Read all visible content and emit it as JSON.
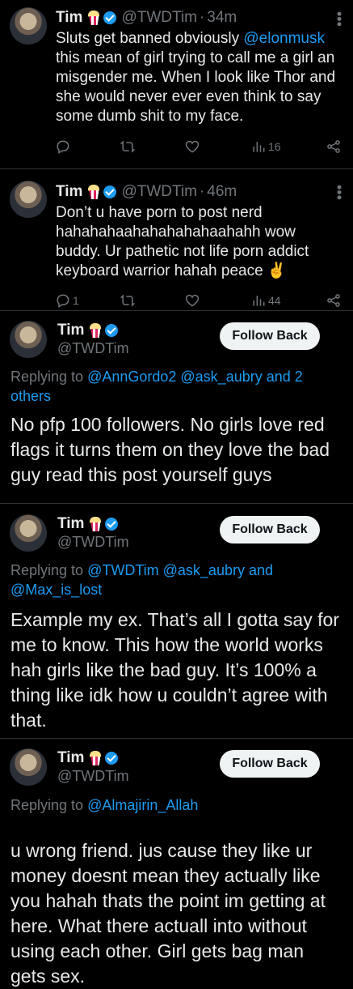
{
  "tweets_compact": [
    {
      "name": "Tim",
      "handle": "@TWDTim",
      "dot": "·",
      "time": "34m",
      "text_before": "Sluts get banned obviously ",
      "mention": "@elonmusk",
      "text_after": " this mean of girl trying to call me a girl an misgender me. When I look like Thor and she would never ever even think to say some dumb shit to my face.",
      "reply_count": "",
      "views": "16"
    },
    {
      "name": "Tim",
      "handle": "@TWDTim",
      "dot": "·",
      "time": "46m",
      "text": "Don’t u have porn to post nerd hahahahaahahahahahaahahh wow buddy. Ur pathetic not life porn addict keyboard warrior hahah peace ✌️",
      "reply_count": "1",
      "views": "44"
    }
  ],
  "tweets_full": [
    {
      "name": "Tim",
      "handle": "@TWDTim",
      "follow_label": "Follow Back",
      "replying_prefix": "Replying to ",
      "replying_mentions": "@AnnGordo2 @ask_aubry",
      "replying_suffix": " and ",
      "replying_others": "2 others",
      "text": "No pfp 100 followers. No girls love red flags it turns them on they love the bad guy read this post yourself guys"
    },
    {
      "name": "Tim",
      "handle": "@TWDTim",
      "follow_label": "Follow Back",
      "replying_prefix": "Replying to ",
      "replying_mentions": "@TWDTim @ask_aubry",
      "replying_suffix": " and ",
      "replying_others": "@Max_is_lost",
      "text": "Example my ex. That’s all I gotta say for me to know. This how the world works hah girls like the bad guy. It’s 100% a thing like idk how u couldn’t agree with that."
    },
    {
      "name": "Tim",
      "handle": "@TWDTim",
      "follow_label": "Follow Back",
      "replying_prefix": "Replying to ",
      "replying_mentions": "@Almajirin_Allah",
      "text": "u wrong friend. jus cause they like ur money doesnt mean they actually like you hahah thats the point im getting at here. What there actuall into without using each other. Girl gets bag man gets sex."
    }
  ],
  "colors": {
    "background": "#000000",
    "text": "#e7e9ea",
    "muted": "#71767b",
    "link": "#1d9bf0",
    "verified": "#1d9bf0",
    "divider": "#2f3336",
    "button_bg": "#eff3f4"
  },
  "icons": [
    "reply-icon",
    "retweet-icon",
    "like-icon",
    "views-icon",
    "share-icon",
    "verified-icon",
    "popcorn-icon",
    "more-icon"
  ]
}
